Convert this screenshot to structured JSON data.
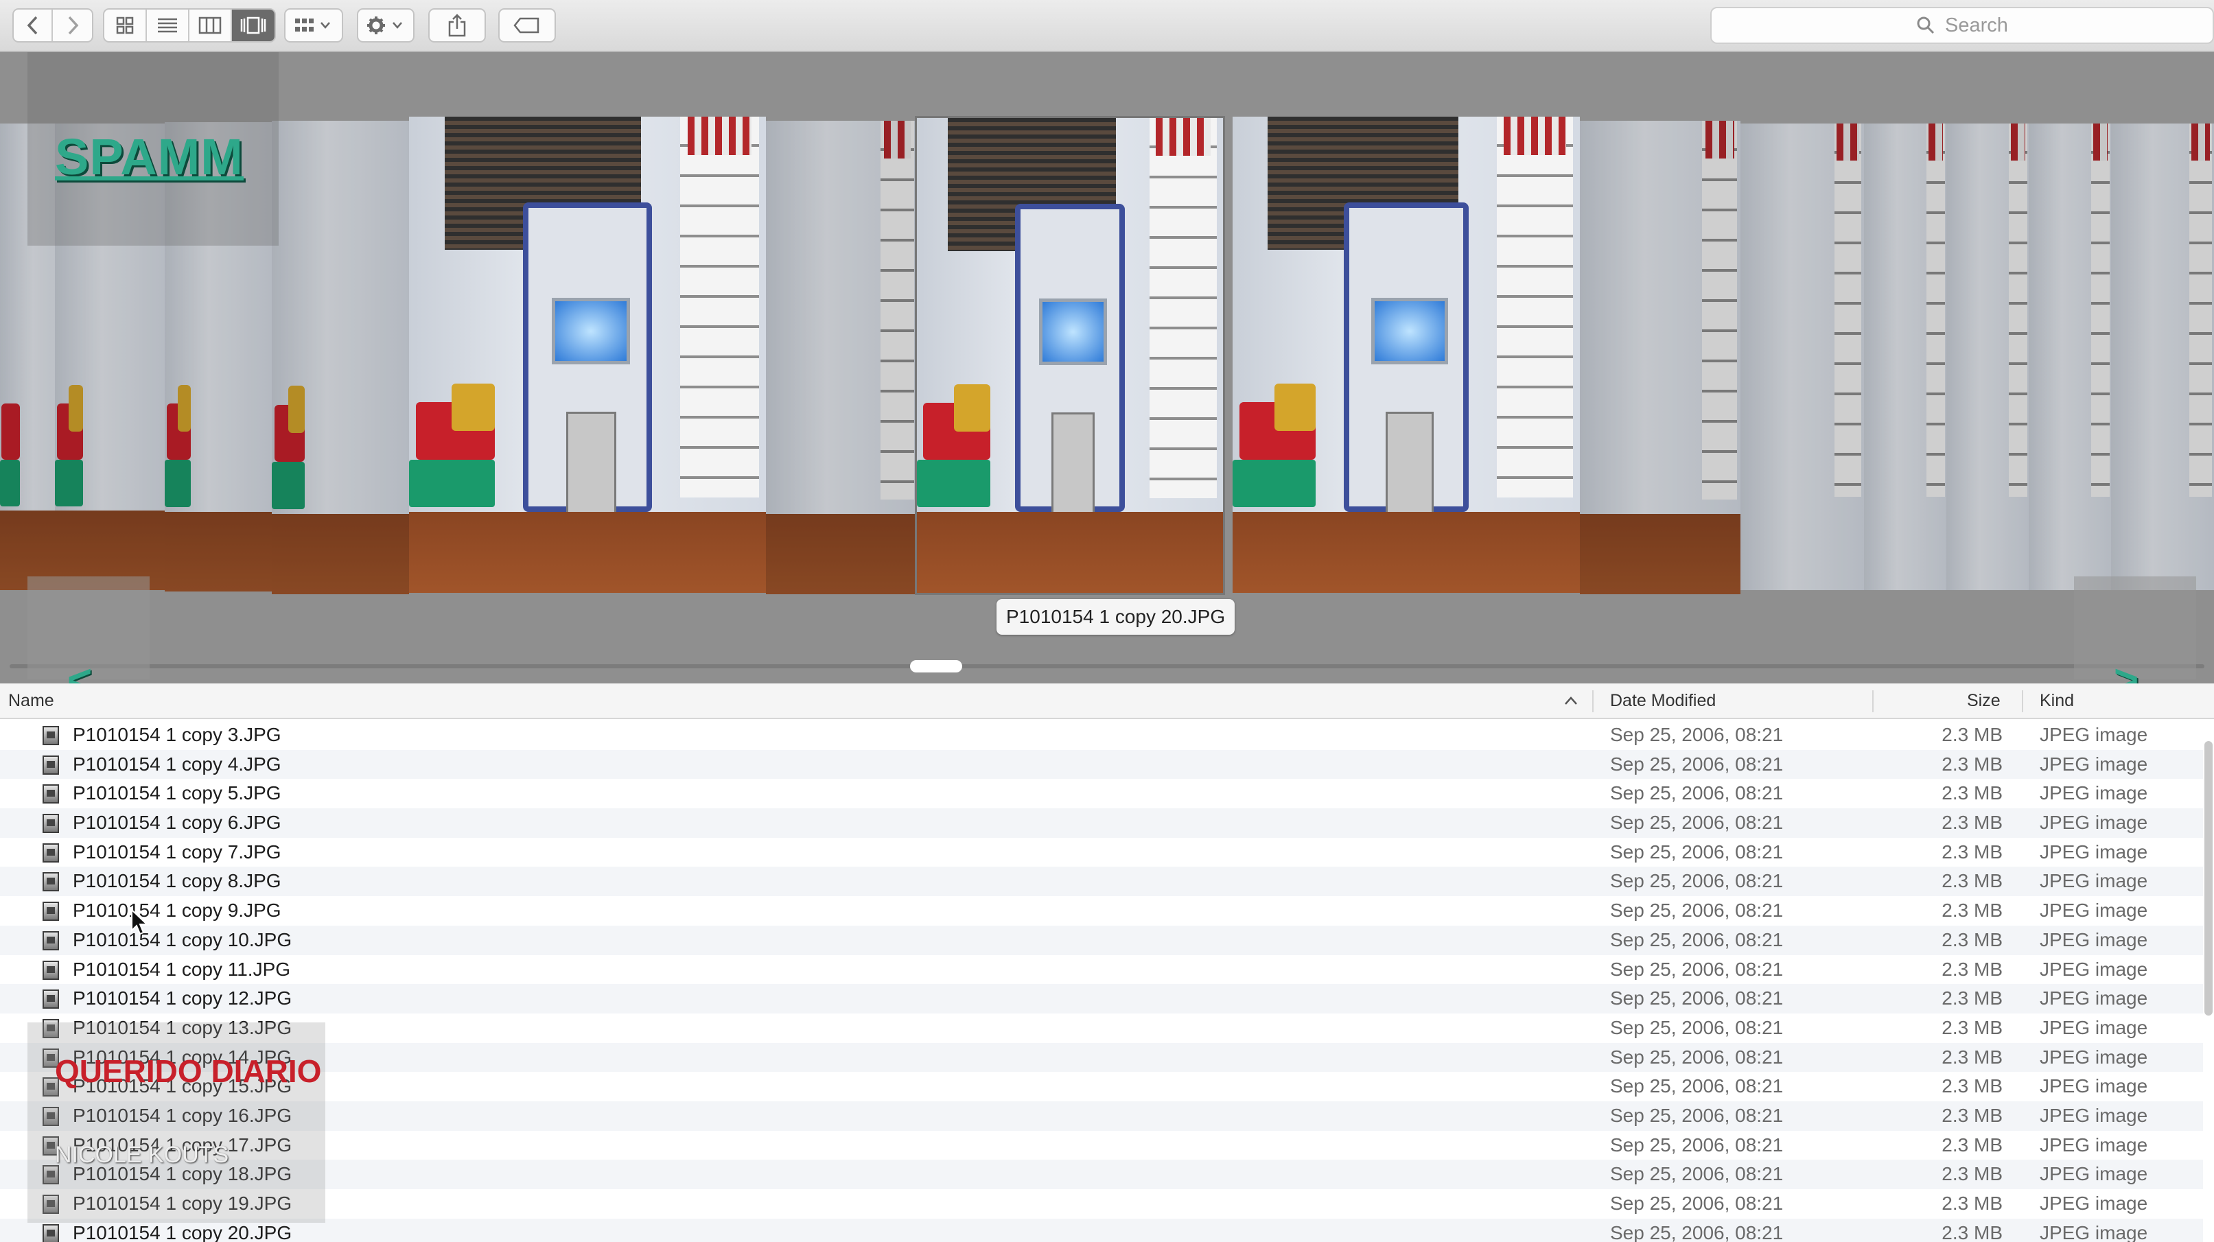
{
  "toolbar": {
    "back_icon": "chevron-left-icon",
    "forward_icon": "chevron-right-icon",
    "view_modes": [
      "icon-view-icon",
      "list-view-icon",
      "column-view-icon",
      "cover-flow-icon"
    ],
    "active_view": "cover-flow-icon",
    "group_icon": "group-by-icon",
    "action_icon": "gear-icon",
    "share_icon": "share-icon",
    "tag_icon": "tag-icon"
  },
  "search": {
    "placeholder": "Search",
    "icon": "search-icon"
  },
  "overlay": {
    "logo": "SPAMM",
    "diary_title": "QUERIDO DIARIO",
    "author": "NICOLE KOUTS",
    "nav_prev": "<",
    "nav_next": ">"
  },
  "coverflow": {
    "selected_caption": "P1010154 1 copy 20.JPG"
  },
  "list": {
    "headers": {
      "name": "Name",
      "date": "Date Modified",
      "size": "Size",
      "kind": "Kind"
    },
    "sort_indicator": "chevron-up-icon",
    "rows": [
      {
        "name": "P1010154 1 copy 3.JPG",
        "date": "Sep 25, 2006, 08:21",
        "size": "2.3 MB",
        "kind": "JPEG image"
      },
      {
        "name": "P1010154 1 copy 4.JPG",
        "date": "Sep 25, 2006, 08:21",
        "size": "2.3 MB",
        "kind": "JPEG image"
      },
      {
        "name": "P1010154 1 copy 5.JPG",
        "date": "Sep 25, 2006, 08:21",
        "size": "2.3 MB",
        "kind": "JPEG image"
      },
      {
        "name": "P1010154 1 copy 6.JPG",
        "date": "Sep 25, 2006, 08:21",
        "size": "2.3 MB",
        "kind": "JPEG image"
      },
      {
        "name": "P1010154 1 copy 7.JPG",
        "date": "Sep 25, 2006, 08:21",
        "size": "2.3 MB",
        "kind": "JPEG image"
      },
      {
        "name": "P1010154 1 copy 8.JPG",
        "date": "Sep 25, 2006, 08:21",
        "size": "2.3 MB",
        "kind": "JPEG image"
      },
      {
        "name": "P1010154 1 copy 9.JPG",
        "date": "Sep 25, 2006, 08:21",
        "size": "2.3 MB",
        "kind": "JPEG image"
      },
      {
        "name": "P1010154 1 copy 10.JPG",
        "date": "Sep 25, 2006, 08:21",
        "size": "2.3 MB",
        "kind": "JPEG image"
      },
      {
        "name": "P1010154 1 copy 11.JPG",
        "date": "Sep 25, 2006, 08:21",
        "size": "2.3 MB",
        "kind": "JPEG image"
      },
      {
        "name": "P1010154 1 copy 12.JPG",
        "date": "Sep 25, 2006, 08:21",
        "size": "2.3 MB",
        "kind": "JPEG image"
      },
      {
        "name": "P1010154 1 copy 13.JPG",
        "date": "Sep 25, 2006, 08:21",
        "size": "2.3 MB",
        "kind": "JPEG image"
      },
      {
        "name": "P1010154 1 copy 14.JPG",
        "date": "Sep 25, 2006, 08:21",
        "size": "2.3 MB",
        "kind": "JPEG image"
      },
      {
        "name": "P1010154 1 copy 15.JPG",
        "date": "Sep 25, 2006, 08:21",
        "size": "2.3 MB",
        "kind": "JPEG image"
      },
      {
        "name": "P1010154 1 copy 16.JPG",
        "date": "Sep 25, 2006, 08:21",
        "size": "2.3 MB",
        "kind": "JPEG image"
      },
      {
        "name": "P1010154 1 copy 17.JPG",
        "date": "Sep 25, 2006, 08:21",
        "size": "2.3 MB",
        "kind": "JPEG image"
      },
      {
        "name": "P1010154 1 copy 18.JPG",
        "date": "Sep 25, 2006, 08:21",
        "size": "2.3 MB",
        "kind": "JPEG image"
      },
      {
        "name": "P1010154 1 copy 19.JPG",
        "date": "Sep 25, 2006, 08:21",
        "size": "2.3 MB",
        "kind": "JPEG image"
      },
      {
        "name": "P1010154 1 copy 20.JPG",
        "date": "Sep 25, 2006, 08:21",
        "size": "2.3 MB",
        "kind": "JPEG image"
      }
    ]
  },
  "colors": {
    "accent_green": "#2ea88a",
    "diary_red": "#c8202a",
    "active_segment": "#6b6b6b"
  }
}
